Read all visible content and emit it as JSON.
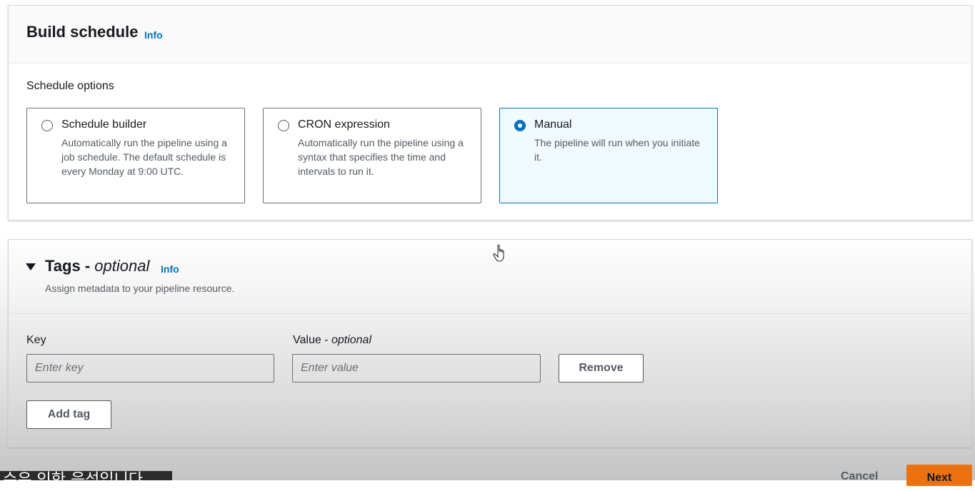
{
  "build_schedule": {
    "title": "Build schedule",
    "info_label": "Info",
    "schedule_options_label": "Schedule options",
    "options": [
      {
        "title": "Schedule builder",
        "description": "Automatically run the pipeline using a job schedule. The default schedule is every Monday at 9:00 UTC.",
        "selected": false
      },
      {
        "title": "CRON expression",
        "description": "Automatically run the pipeline using a syntax that specifies the time and intervals to run it.",
        "selected": false
      },
      {
        "title": "Manual",
        "description": "The pipeline will run when you initiate it.",
        "selected": true
      }
    ]
  },
  "tags": {
    "title": "Tags - ",
    "title_optional": "optional",
    "info_label": "Info",
    "description": "Assign metadata to your pipeline resource.",
    "key_label": "Key",
    "value_label": "Value - ",
    "value_label_optional": "optional",
    "key_placeholder": "Enter key",
    "value_placeholder": "Enter value",
    "remove_label": "Remove",
    "add_tag_label": "Add tag"
  },
  "footer": {
    "cancel_label": "Cancel",
    "next_label": "Next"
  },
  "subtitle_overlay": "수유 인한 음성입니다",
  "colors": {
    "accent": "#0073bb",
    "primary_button": "#ec7211",
    "selected_tile_bg": "#f1faff"
  },
  "icons": {
    "cursor": "hand-pointer-icon",
    "expand": "caret-down-icon"
  }
}
